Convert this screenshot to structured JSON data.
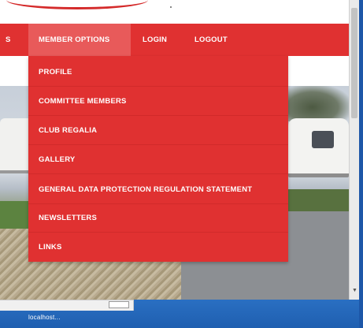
{
  "navbar": {
    "items": [
      {
        "label": "S"
      },
      {
        "label": "MEMBER OPTIONS"
      },
      {
        "label": "LOGIN"
      },
      {
        "label": "LOGOUT"
      }
    ]
  },
  "dropdown": {
    "items": [
      {
        "label": "PROFILE"
      },
      {
        "label": "COMMITTEE MEMBERS"
      },
      {
        "label": "CLUB REGALIA"
      },
      {
        "label": "GALLERY"
      },
      {
        "label": "GENERAL DATA PROTECTION REGULATION STATEMENT"
      },
      {
        "label": "NEWSLETTERS"
      },
      {
        "label": "LINKS"
      }
    ]
  },
  "status_bar": {
    "text": "localhost..."
  },
  "colors": {
    "nav_red": "#e03131",
    "nav_active": "#e85a5a",
    "taskbar_blue": "#1f5fb0"
  }
}
